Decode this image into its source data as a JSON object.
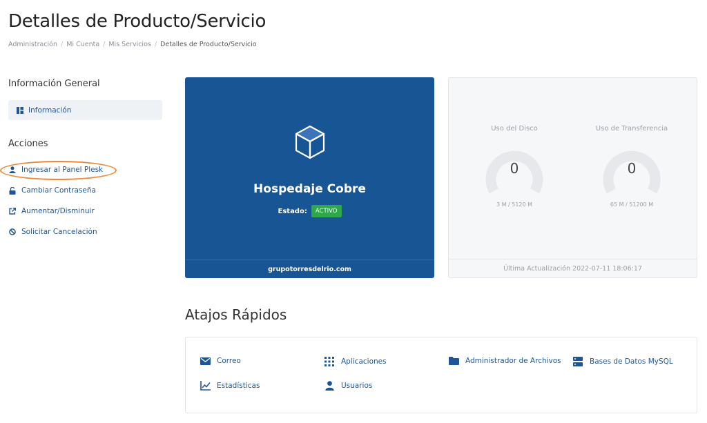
{
  "page": {
    "title": "Detalles de Producto/Servicio"
  },
  "breadcrumb": [
    "Administración",
    "Mi Cuenta",
    "Mis Servicios",
    "Detalles de Producto/Servicio"
  ],
  "sidebar": {
    "general_title": "Información General",
    "info_item": "Información",
    "actions_title": "Acciones",
    "actions": [
      {
        "label": "Ingresar al Panel Plesk",
        "icon": "user-icon"
      },
      {
        "label": "Cambiar Contraseña",
        "icon": "unlock-icon"
      },
      {
        "label": "Aumentar/Disminuir",
        "icon": "external-link-icon"
      },
      {
        "label": "Solicitar Cancelación",
        "icon": "ban-icon"
      }
    ]
  },
  "product": {
    "name": "Hospedaje Cobre",
    "status_label": "Estado:",
    "status": "ACTIVO",
    "domain": "grupotorresdelrio.com",
    "icon": "cube-icon"
  },
  "usage": {
    "disk": {
      "label": "Uso del Disco",
      "value": "0",
      "detail": "3 M / 5120 M",
      "fraction": 0
    },
    "transfer": {
      "label": "Uso de Transferencia",
      "value": "0",
      "detail": "65 M / 51200 M",
      "fraction": 0
    },
    "last_update": "Última Actualización 2022-07-11 18:06:17"
  },
  "shortcuts": {
    "title": "Atajos Rápidos",
    "items": [
      {
        "label": "Correo",
        "icon": "envelope-icon"
      },
      {
        "label": "Aplicaciones",
        "icon": "grid-icon"
      },
      {
        "label": "Administrador de Archivos",
        "icon": "folder-icon"
      },
      {
        "label": "Bases de Datos MySQL",
        "icon": "database-icon"
      },
      {
        "label": "Estadísticas",
        "icon": "chart-line-icon"
      },
      {
        "label": "Usuarios",
        "icon": "user-icon"
      }
    ]
  },
  "colors": {
    "primary": "#185594",
    "link": "#1e5597",
    "active_badge": "#2ea84a",
    "highlight": "#f08632"
  }
}
